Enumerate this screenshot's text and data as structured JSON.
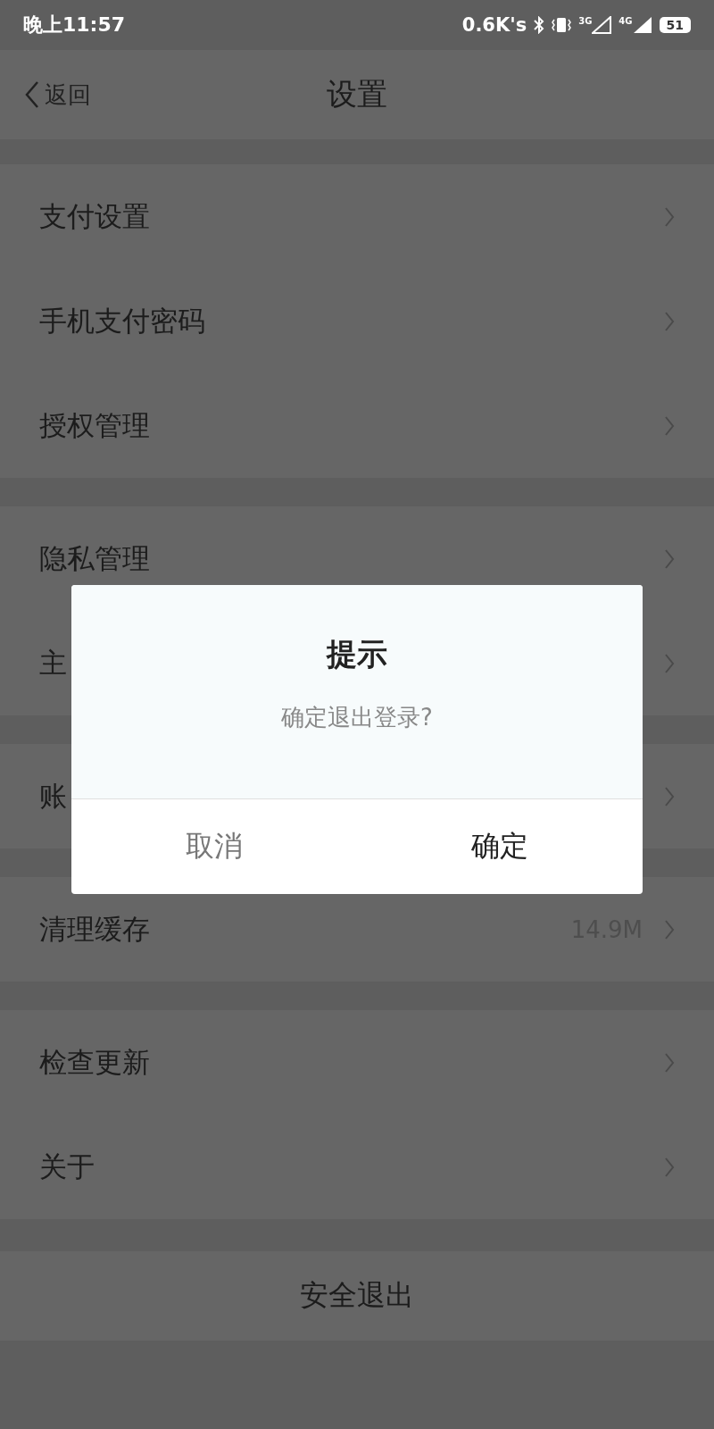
{
  "status_bar": {
    "time": "晚上11:57",
    "speed": "0.6K's",
    "network_1": "3G",
    "network_2": "4G",
    "battery": "51"
  },
  "nav": {
    "back": "返回",
    "title": "设置"
  },
  "sections": [
    {
      "rows": [
        {
          "label": "支付设置"
        },
        {
          "label": "手机支付密码"
        },
        {
          "label": "授权管理"
        }
      ]
    },
    {
      "rows": [
        {
          "label": "隐私管理"
        },
        {
          "label": "主"
        }
      ]
    },
    {
      "rows": [
        {
          "label": "账"
        }
      ]
    },
    {
      "rows": [
        {
          "label": "清理缓存",
          "value": "14.9M"
        }
      ]
    },
    {
      "rows": [
        {
          "label": "检查更新"
        },
        {
          "label": "关于"
        }
      ]
    }
  ],
  "logout": "安全退出",
  "dialog": {
    "title": "提示",
    "message": "确定退出登录?",
    "cancel": "取消",
    "confirm": "确定"
  }
}
